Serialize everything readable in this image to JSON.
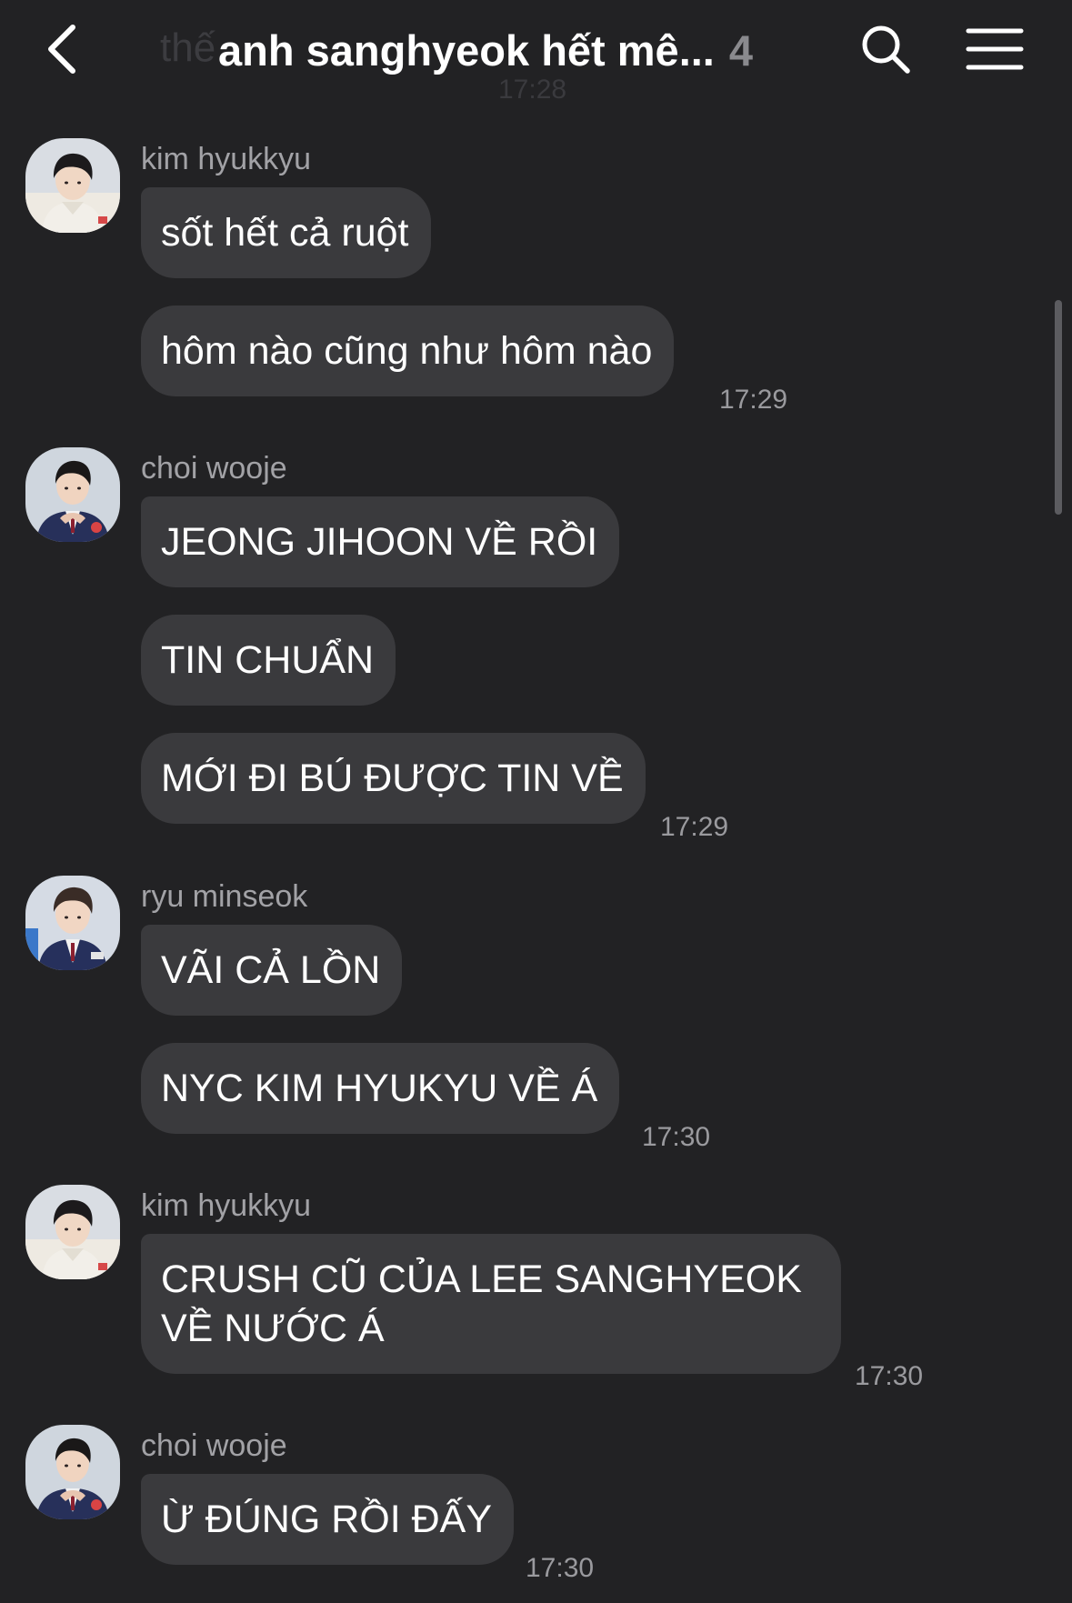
{
  "header": {
    "back_icon": "chevron-left-icon",
    "title": "anh sanghyeok hết mê...",
    "member_count": "4",
    "search_icon": "search-icon",
    "menu_icon": "hamburger-menu-icon",
    "ghost_text": "thế",
    "ghost_time": "17:28"
  },
  "messages": [
    {
      "sender": "kim hyukkyu",
      "bubbles": [
        "sốt hết cả ruột",
        "hôm nào cũng như hôm nào"
      ],
      "time": "17:29"
    },
    {
      "sender": "choi wooje",
      "bubbles": [
        "JEONG JIHOON VỀ RỒI",
        "TIN CHUẨN",
        "MỚI ĐI BÚ ĐƯỢC TIN VỀ"
      ],
      "time": "17:29"
    },
    {
      "sender": "ryu minseok",
      "bubbles": [
        "VÃI CẢ LỒN",
        "NYC KIM HYUKYU VỀ Á"
      ],
      "time": "17:30"
    },
    {
      "sender": "kim hyukkyu",
      "bubbles": [
        "CRUSH CŨ CỦA LEE SANGHYEOK VỀ NƯỚC Á"
      ],
      "time": "17:30"
    },
    {
      "sender": "choi wooje",
      "bubbles": [
        "Ừ ĐÚNG RỒI ĐẤY"
      ],
      "time": "17:30"
    }
  ],
  "colors": {
    "background": "#222224",
    "bubble": "#3a3a3d",
    "sender_text": "#a2a2a6",
    "time_text": "#9a9a9e",
    "count_text": "#8a8a8e"
  }
}
